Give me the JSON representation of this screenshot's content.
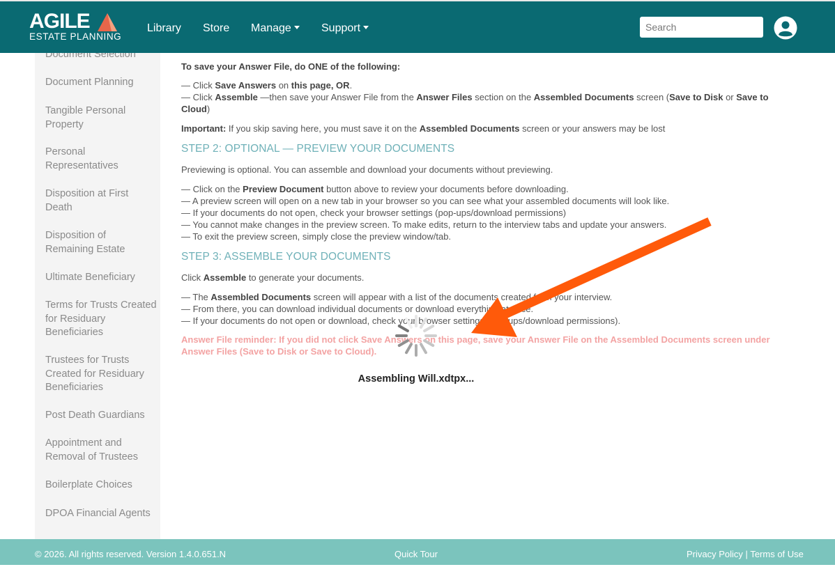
{
  "brand": {
    "name": "AGILE",
    "subtitle": "ESTATE PLANNING",
    "colors": {
      "navbar": "#0a6a72",
      "accent": "#e8664a",
      "footer": "#7bc4bd",
      "heading": "#6fb1b8",
      "reminder": "#f3a3a3",
      "arrow": "#ff5a0a"
    }
  },
  "nav": {
    "items": [
      {
        "label": "Library"
      },
      {
        "label": "Store"
      },
      {
        "label": "Manage"
      },
      {
        "label": "Support"
      }
    ],
    "search_placeholder": "Search",
    "user_icon": "user-circle-icon"
  },
  "sidebar": {
    "items": [
      {
        "label": "Document Selection"
      },
      {
        "label": "Document Planning"
      },
      {
        "label": "Tangible Personal Property"
      },
      {
        "label": "Personal Representatives"
      },
      {
        "label": "Disposition at First Death"
      },
      {
        "label": "Disposition of Remaining Estate"
      },
      {
        "label": "Ultimate Beneficiary"
      },
      {
        "label": "Terms for Trusts Created for Residuary Beneficiaries"
      },
      {
        "label": "Trustees for Trusts Created for Residuary Beneficiaries"
      },
      {
        "label": "Post Death Guardians"
      },
      {
        "label": "Appointment and Removal of Trustees"
      },
      {
        "label": "Boilerplate Choices"
      },
      {
        "label": "DPOA Financial Agents"
      }
    ]
  },
  "main": {
    "intro_title": "To save your Answer File, do ONE of the following:",
    "save_lines": {
      "l1_pre": "— Click ",
      "l1_b1": "Save Answers",
      "l1_mid": " on ",
      "l1_b2": "this page, OR",
      "l1_end": ".",
      "l2_pre": "— Click ",
      "l2_b1": "Assemble",
      "l2_mid1": " —then save your Answer File from the ",
      "l2_b2": "Answer Files",
      "l2_mid2": " section on the ",
      "l2_b3": "Assembled Documents",
      "l2_mid3": " screen (",
      "l2_b4": "Save to Disk",
      "l2_mid4": " or ",
      "l2_b5": "Save to Cloud",
      "l2_end": ")"
    },
    "important": {
      "label": "Important:",
      "text1": " If you skip saving here, you must save it on the ",
      "bold": "Assembled Documents",
      "text2": " screen or your answers may be lost"
    },
    "step2": {
      "heading": "STEP 2: OPTIONAL — PREVIEW YOUR DOCUMENTS",
      "intro": "Previewing is optional. You can assemble and download your documents without previewing.",
      "b1_pre": "— Click on the ",
      "b1_bold": "Preview Document",
      "b1_post": " button above to review your documents before downloading.",
      "b2": "— A preview screen will open on a new tab in your browser so you can see what your assembled documents will look like.",
      "b3": "— If your documents do not open, check your browser settings (pop-ups/download permissions)",
      "b4": "— You cannot make changes in the preview screen. To make edits, return to the interview tabs and update your answers.",
      "b5": "— To exit the preview screen, simply close the preview window/tab."
    },
    "step3": {
      "heading": "STEP 3: ASSEMBLE YOUR DOCUMENTS",
      "intro_pre": "Click ",
      "intro_bold": "Assemble",
      "intro_post": " to generate your documents.",
      "b1_pre": "— The ",
      "b1_bold": "Assembled Documents",
      "b1_post": " screen will appear with a list of the documents created from your interview.",
      "b2": "— From there, you can download individual documents or download everything at once.",
      "b3": "— If your documents do not open or download, check your browser settings (pop-ups/download permissions)."
    },
    "reminder": "Answer File reminder: If you did not click Save Answers on this page, save your Answer File on the Assembled Documents screen under Answer Files (Save to Disk or Save to Cloud).",
    "assembling": "Assembling Will.xdtpx..."
  },
  "footer": {
    "copyright": "© 2026. All rights reserved. Version 1.4.0.651.N",
    "quick_tour": "Quick Tour",
    "privacy": "Privacy Policy",
    "separator": "|",
    "terms": "Terms of Use"
  }
}
